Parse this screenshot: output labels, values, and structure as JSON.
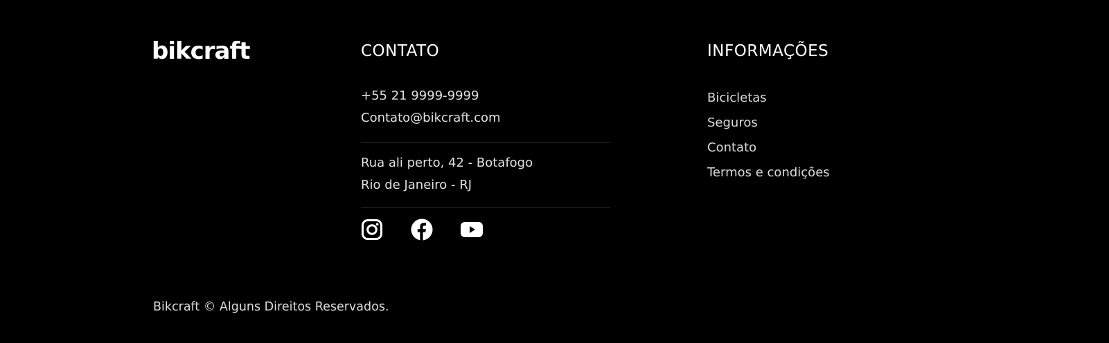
{
  "brand": {
    "logo_text": "bikcraft"
  },
  "contato": {
    "title": "CONTATO",
    "phone": "+55 21 9999-9999",
    "email": "Contato@bikcraft.com",
    "address_line1": "Rua ali perto, 42 - Botafogo",
    "address_line2": "Rio de Janeiro - RJ",
    "socials": [
      {
        "icon": "instagram-icon"
      },
      {
        "icon": "facebook-icon"
      },
      {
        "icon": "youtube-icon"
      }
    ]
  },
  "informacoes": {
    "title": "INFORMAÇÕES",
    "links": [
      {
        "label": "Bicicletas"
      },
      {
        "label": "Seguros"
      },
      {
        "label": "Contato"
      },
      {
        "label": "Termos e condições"
      }
    ]
  },
  "footer": {
    "copyright": "Bikcraft © Alguns Direitos Reservados."
  },
  "colors": {
    "background": "#000000",
    "text": "#ffffff",
    "muted_text": "#dcdcdc",
    "divider": "#2a2a2a"
  }
}
